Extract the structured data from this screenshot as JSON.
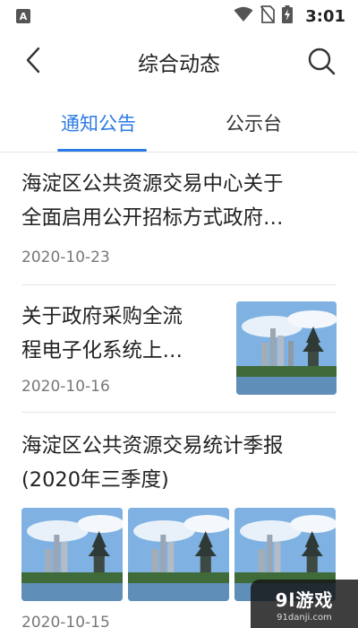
{
  "status_bar": {
    "badge": "A",
    "time": "3:01",
    "icons": [
      "wifi-icon",
      "no-sim-icon",
      "battery-charging-icon"
    ]
  },
  "header": {
    "title": "综合动态",
    "back_icon": "chevron-left-icon",
    "search_icon": "search-icon"
  },
  "tabs": [
    {
      "label": "通知公告",
      "active": true
    },
    {
      "label": "公示台",
      "active": false
    }
  ],
  "articles": [
    {
      "title_line1": "海淀区公共资源交易中心关于",
      "title_line2": "全面启用公开招标方式政府…",
      "date": "2020-10-23"
    },
    {
      "title_line1": "关于政府采购全流",
      "title_line2": "程电子化系统上…",
      "date": "2020-10-16"
    },
    {
      "title_line1": "海淀区公共资源交易统计季报",
      "title_line2": "(2020年三季度)",
      "date": "2020-10-15"
    }
  ],
  "watermark": {
    "main": "9l游戏",
    "sub": "91danji.com"
  },
  "colors": {
    "accent": "#2c7be5",
    "divider": "#e6e6e6",
    "date": "#777777"
  }
}
